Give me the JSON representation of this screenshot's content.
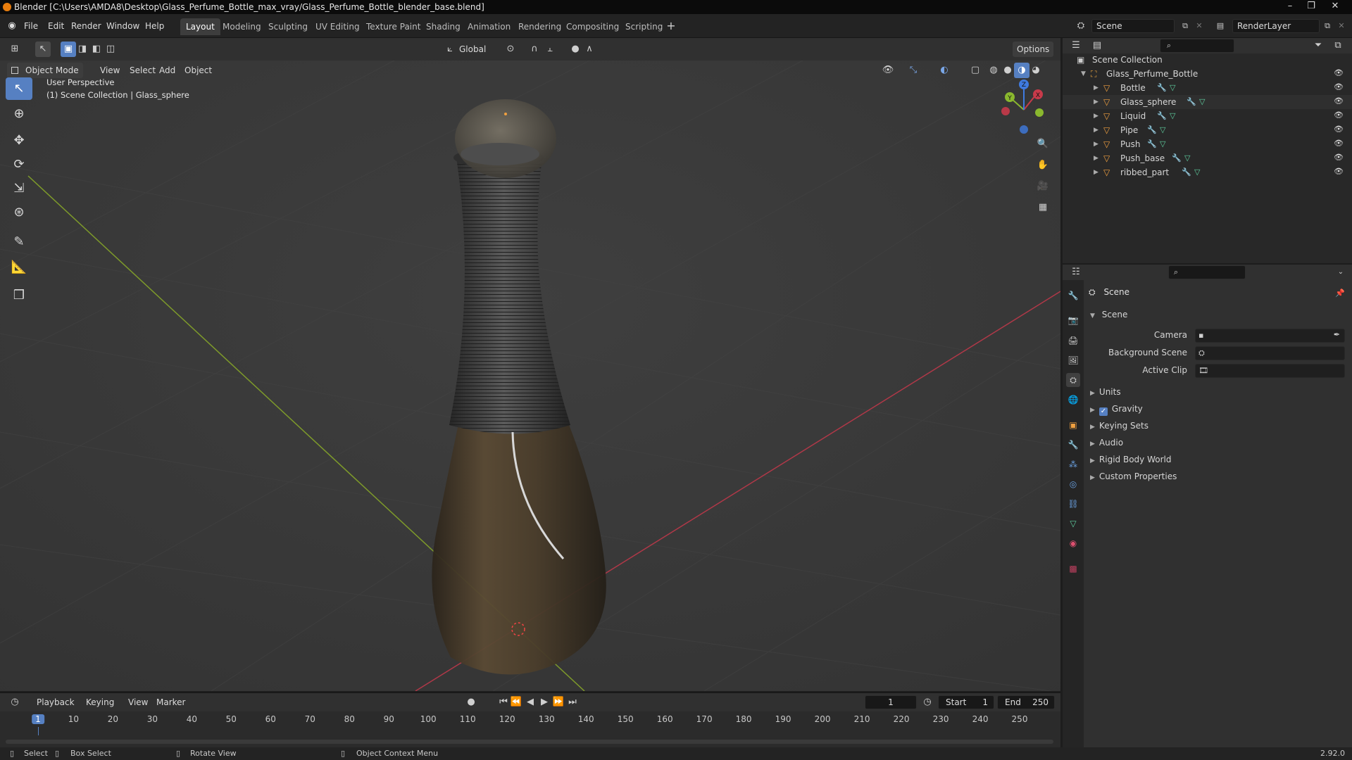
{
  "window": {
    "title": "Blender [C:\\Users\\AMDA8\\Desktop\\Glass_Perfume_Bottle_max_vray/Glass_Perfume_Bottle_blender_base.blend]"
  },
  "menubar": {
    "items": [
      "File",
      "Edit",
      "Render",
      "Window",
      "Help"
    ]
  },
  "workspaces": [
    "Layout",
    "Modeling",
    "Sculpting",
    "UV Editing",
    "Texture Paint",
    "Shading",
    "Animation",
    "Rendering",
    "Compositing",
    "Scripting"
  ],
  "active_workspace": "Layout",
  "scene_selector": {
    "value": "Scene"
  },
  "render_layer": {
    "value": "RenderLayer"
  },
  "viewport_header": {
    "mode": "Object Mode",
    "menus": [
      "View",
      "Select",
      "Add",
      "Object"
    ],
    "transform_orientation": "Global",
    "options_label": "Options"
  },
  "viewport": {
    "overlay_line1": "User Perspective",
    "overlay_line2": "(1) Scene Collection | Glass_sphere",
    "gizmo": {
      "x": "X",
      "y": "Y",
      "z": "Z"
    }
  },
  "outliner": {
    "root": "Scene Collection",
    "collection": "Glass_Perfume_Bottle",
    "objects": [
      "Bottle",
      "Glass_sphere",
      "Liquid",
      "Pipe",
      "Push",
      "Push_base",
      "ribbed_part"
    ]
  },
  "properties": {
    "header": "Scene",
    "panel_title": "Scene",
    "fields": [
      {
        "label": "Camera",
        "value": ""
      },
      {
        "label": "Background Scene",
        "value": ""
      },
      {
        "label": "Active Clip",
        "value": ""
      }
    ],
    "sections": [
      "Units",
      "Gravity",
      "Keying Sets",
      "Audio",
      "Rigid Body World",
      "Custom Properties"
    ],
    "gravity_checked": true
  },
  "timeline": {
    "menus": [
      "Playback",
      "Keying",
      "View",
      "Marker"
    ],
    "current_frame": "1",
    "start_label": "Start",
    "start_value": "1",
    "end_label": "End",
    "end_value": "250",
    "ticks": [
      "1",
      "10",
      "20",
      "30",
      "40",
      "50",
      "60",
      "70",
      "80",
      "90",
      "100",
      "110",
      "120",
      "130",
      "140",
      "150",
      "160",
      "170",
      "180",
      "190",
      "200",
      "210",
      "220",
      "230",
      "240",
      "250"
    ]
  },
  "statusbar": {
    "select": "Select",
    "box_select": "Box Select",
    "rotate_view": "Rotate View",
    "context_menu": "Object Context Menu",
    "version": "2.92.0"
  },
  "colors": {
    "accent": "#5680c2",
    "object_orange": "#f0a040",
    "x_axis": "#c83a4a",
    "y_axis": "#8ab82e"
  }
}
